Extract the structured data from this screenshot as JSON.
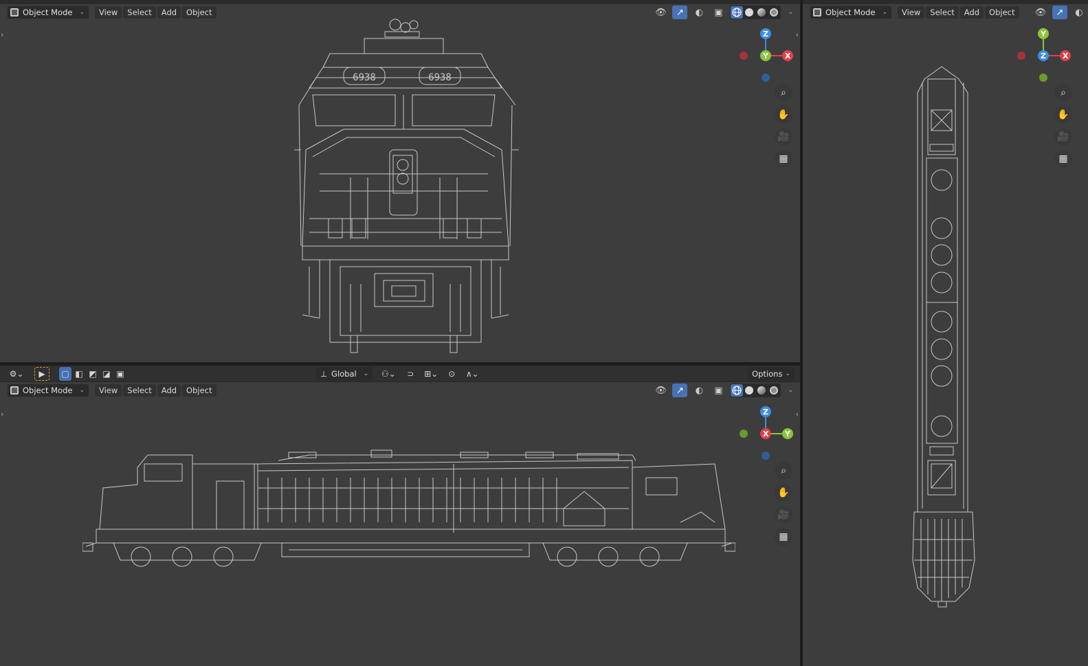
{
  "colors": {
    "viewport_bg": "#3d3d3d",
    "header_bg": "#303030",
    "accent_blue": "#4772b3",
    "axis_x": "#e0414a",
    "axis_y": "#8ac53a",
    "axis_z": "#3f8ee0",
    "wireframe": "#c8c8c8",
    "selection_orange": "#e69a28"
  },
  "header": {
    "mode_label": "Object Mode",
    "menus": [
      "View",
      "Select",
      "Add",
      "Object"
    ]
  },
  "toolbar": {
    "transform_orientation": "Global",
    "options_label": "Options"
  },
  "gizmo_front": {
    "top": "Z",
    "center": "Y",
    "right": "X"
  },
  "gizmo_side": {
    "top": "Z",
    "center": "X",
    "right": "Y"
  },
  "gizmo_top": {
    "top": "Y",
    "center": "Z",
    "right": "X"
  },
  "model": {
    "cab_number": "6938"
  },
  "icons": {
    "zoom": "zoom-icon",
    "pan": "hand-icon",
    "camera": "camera-icon",
    "grid": "grid-icon",
    "visibility": "eye-icon",
    "gizmo_toggle": "gizmo-icon",
    "overlay": "overlay-icon",
    "xray": "xray-icon",
    "shading": "shading-icon"
  }
}
